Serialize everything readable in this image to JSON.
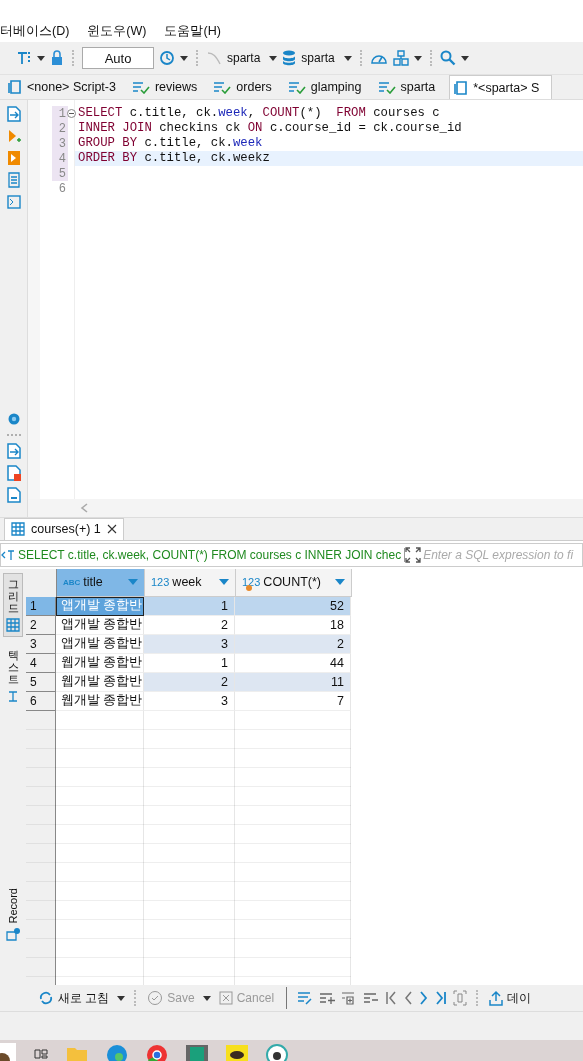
{
  "menu": [
    "터베이스(D)",
    "윈도우(W)",
    "도움말(H)"
  ],
  "toolbar": {
    "mode_field": "Auto",
    "datasource": "sparta",
    "database": "sparta"
  },
  "editor_tabs": [
    {
      "label": "<none> Script-3",
      "kind": "script",
      "selected": false
    },
    {
      "label": "reviews",
      "kind": "table",
      "selected": false
    },
    {
      "label": "orders",
      "kind": "table",
      "selected": false
    },
    {
      "label": "glamping",
      "kind": "table",
      "selected": false
    },
    {
      "label": "sparta",
      "kind": "table",
      "selected": false
    },
    {
      "label": "*<sparta> S",
      "kind": "script",
      "selected": true
    }
  ],
  "editor": {
    "lines": [
      {
        "number": "1",
        "collapsible": true,
        "current": false,
        "in_query": true,
        "tokens": [
          {
            "kind": "keyword",
            "text": "SELECT"
          },
          {
            "kind": "plain",
            "text": " c.title, ck."
          },
          {
            "kind": "field",
            "text": "week"
          },
          {
            "kind": "plain",
            "text": ", "
          },
          {
            "kind": "keyword",
            "text": "COUNT"
          },
          {
            "kind": "plain",
            "text": "(*)  "
          },
          {
            "kind": "keyword",
            "text": "FROM"
          },
          {
            "kind": "plain",
            "text": " courses c"
          }
        ]
      },
      {
        "number": "2",
        "collapsible": false,
        "current": false,
        "in_query": true,
        "tokens": [
          {
            "kind": "keyword",
            "text": "INNER JOIN"
          },
          {
            "kind": "plain",
            "text": " checkins ck "
          },
          {
            "kind": "keyword",
            "text": "ON"
          },
          {
            "kind": "plain",
            "text": " c.course_id = ck.course_id"
          }
        ]
      },
      {
        "number": "3",
        "collapsible": false,
        "current": false,
        "in_query": true,
        "tokens": [
          {
            "kind": "keyword",
            "text": "GROUP BY"
          },
          {
            "kind": "plain",
            "text": " c.title, ck."
          },
          {
            "kind": "field",
            "text": "week"
          }
        ]
      },
      {
        "number": "4",
        "collapsible": false,
        "current": true,
        "in_query": true,
        "tokens": [
          {
            "kind": "keyword",
            "text": "ORDER BY"
          },
          {
            "kind": "plain",
            "text": " c.title, ck.weekz"
          }
        ]
      },
      {
        "number": "5",
        "collapsible": false,
        "current": false,
        "in_query": true
      },
      {
        "number": "6",
        "collapsible": false,
        "current": false,
        "in_query": false
      }
    ]
  },
  "results_tab": {
    "label": "courses(+) 1"
  },
  "filter": {
    "query": "SELECT c.title, ck.week, COUNT(*) FROM courses c INNER JOIN chec",
    "placeholder": "Enter a SQL expression to fi"
  },
  "view_tabs": [
    {
      "label": "그리드",
      "kind": "grid",
      "selected": true
    },
    {
      "label": "텍스트",
      "kind": "text",
      "selected": false
    },
    {
      "label": "Record",
      "kind": "record",
      "selected": false
    }
  ],
  "grid": {
    "columns": [
      {
        "type_label": "ABC",
        "name": "title",
        "kind": "text",
        "selected": true
      },
      {
        "type_label": "123",
        "name": "week",
        "kind": "number",
        "selected": false
      },
      {
        "type_label": "123",
        "name": "COUNT(*)",
        "kind": "computed",
        "selected": false
      }
    ],
    "rows": [
      {
        "number": "1",
        "selected": true,
        "cells": [
          "앱개발 종합반",
          "1",
          "52"
        ]
      },
      {
        "number": "2",
        "selected": false,
        "cells": [
          "앱개발 종합반",
          "2",
          "18"
        ]
      },
      {
        "number": "3",
        "selected": false,
        "cells": [
          "앱개발 종합반",
          "3",
          "2"
        ]
      },
      {
        "number": "4",
        "selected": false,
        "cells": [
          "웹개발 종합반",
          "1",
          "44"
        ]
      },
      {
        "number": "5",
        "selected": false,
        "cells": [
          "웹개발 종합반",
          "2",
          "11"
        ]
      },
      {
        "number": "6",
        "selected": false,
        "cells": [
          "웹개발 종합반",
          "3",
          "7"
        ]
      }
    ]
  },
  "bottom_toolbar": {
    "refresh": "새로 고침",
    "save": {
      "label": "Save",
      "disabled": true
    },
    "cancel": {
      "label": "Cancel",
      "disabled": true
    },
    "export": "데이"
  }
}
